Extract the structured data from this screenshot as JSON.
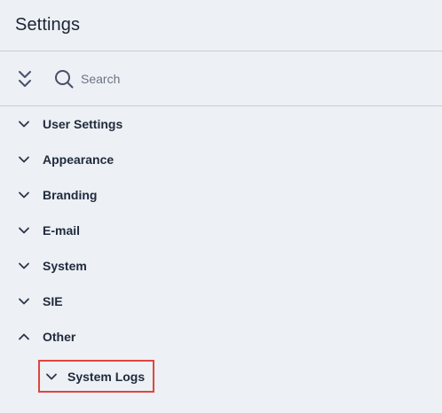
{
  "header": {
    "title": "Settings"
  },
  "toolbar": {
    "collapse_icon": "double-chevron-down-icon",
    "search_icon": "search-icon",
    "search_placeholder": "Search",
    "search_value": ""
  },
  "tree": {
    "items": [
      {
        "label": "User Settings",
        "state": "collapsed",
        "icon": "chevron-down-icon"
      },
      {
        "label": "Appearance",
        "state": "collapsed",
        "icon": "chevron-down-icon"
      },
      {
        "label": "Branding",
        "state": "collapsed",
        "icon": "chevron-down-icon"
      },
      {
        "label": "E-mail",
        "state": "collapsed",
        "icon": "chevron-down-icon"
      },
      {
        "label": "System",
        "state": "collapsed",
        "icon": "chevron-down-icon"
      },
      {
        "label": "SIE",
        "state": "collapsed",
        "icon": "chevron-down-icon"
      },
      {
        "label": "Other",
        "state": "expanded",
        "icon": "chevron-up-icon"
      }
    ],
    "children": {
      "other": [
        {
          "label": "System Logs",
          "state": "collapsed",
          "icon": "chevron-down-icon",
          "highlighted": true
        }
      ]
    }
  },
  "colors": {
    "background": "#edf0f4",
    "divider": "#c9cfd8",
    "text": "#1f2a3d",
    "placeholder": "#6b7486",
    "highlight_border": "#e0453f"
  }
}
